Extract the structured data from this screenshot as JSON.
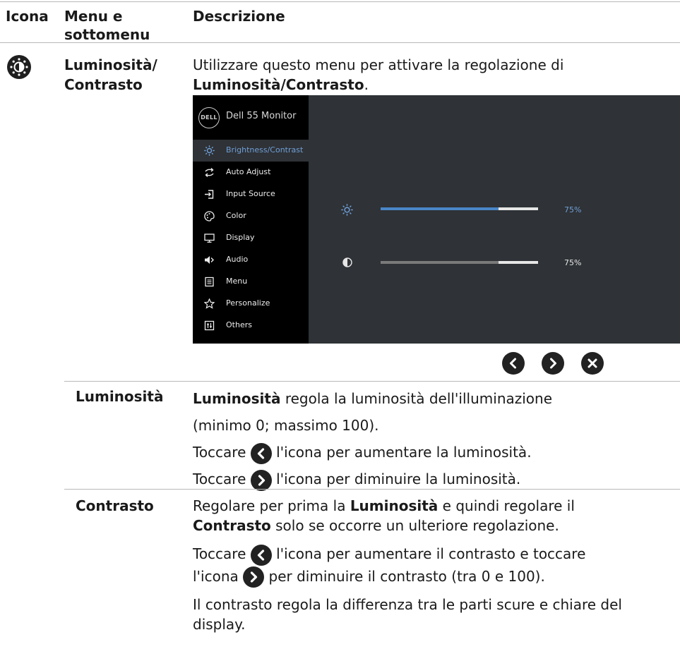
{
  "table_header": {
    "col1": "Icona",
    "col2_line1": "Menu e",
    "col2_line2": "sottomenu",
    "col3": "Descrizione"
  },
  "row_brightness_contrast": {
    "menu_line1": "Luminosità/",
    "menu_line2": "Contrasto",
    "desc_prefix": "Utilizzare questo menu per attivare la regolazione di",
    "desc_bold": "Luminosità/Contrasto",
    "desc_suffix": ".",
    "icon": "brightness-contrast-icon"
  },
  "osd": {
    "logo_text": "DELL",
    "title": "Dell 55 Monitor",
    "menu_items": [
      {
        "label": "Brightness/Contrast",
        "icon": "sun-icon",
        "selected": true
      },
      {
        "label": "Auto Adjust",
        "icon": "auto-adjust-icon",
        "selected": false
      },
      {
        "label": "Input Source",
        "icon": "input-source-icon",
        "selected": false
      },
      {
        "label": "Color",
        "icon": "color-palette-icon",
        "selected": false
      },
      {
        "label": "Display",
        "icon": "display-icon",
        "selected": false
      },
      {
        "label": "Audio",
        "icon": "speaker-icon",
        "selected": false
      },
      {
        "label": "Menu",
        "icon": "menu-doc-icon",
        "selected": false
      },
      {
        "label": "Personalize",
        "icon": "star-icon",
        "selected": false
      },
      {
        "label": "Others",
        "icon": "others-icon",
        "selected": false
      }
    ],
    "brightness": {
      "value": 75,
      "label": "75%",
      "fill_color": "#4a86c8",
      "icon": "sun-icon"
    },
    "contrast": {
      "value": 75,
      "label": "75%",
      "fill_color": "#7a7a7a",
      "icon": "contrast-icon"
    },
    "colors": {
      "panel": "#2f3236",
      "sidebar": "#000000",
      "accent": "#6f9fd8"
    }
  },
  "nav_buttons": [
    "chevron-left-icon",
    "chevron-right-icon",
    "close-icon"
  ],
  "row_luminosita": {
    "menu": "Luminosità",
    "line1_bold": "Luminosità",
    "line1_rest": " regola la luminosità dell'illuminazione",
    "line2": "(minimo 0; massimo 100).",
    "line3_pre": "Toccare ",
    "line3_post": "l'icona per aumentare la luminosità.",
    "line4_pre": "Toccare ",
    "line4_post": "l'icona per diminuire la luminosità."
  },
  "row_contrasto": {
    "menu": "Contrasto",
    "p1_a": "Regolare per prima la ",
    "p1_b": "Luminosità",
    "p1_c": " e quindi regolare il",
    "p1_d": "Contrasto",
    "p1_e": " solo se occorre un ulteriore regolazione.",
    "p2_a": "Toccare ",
    "p2_b": "l'icona per aumentare il contrasto e toccare",
    "p2_c": "l'icona ",
    "p2_d": " per diminuire il contrasto (tra 0 e 100).",
    "p3_line1": "Il contrasto regola la differenza tra le parti scure e chiare del",
    "p3_line2": "display."
  }
}
